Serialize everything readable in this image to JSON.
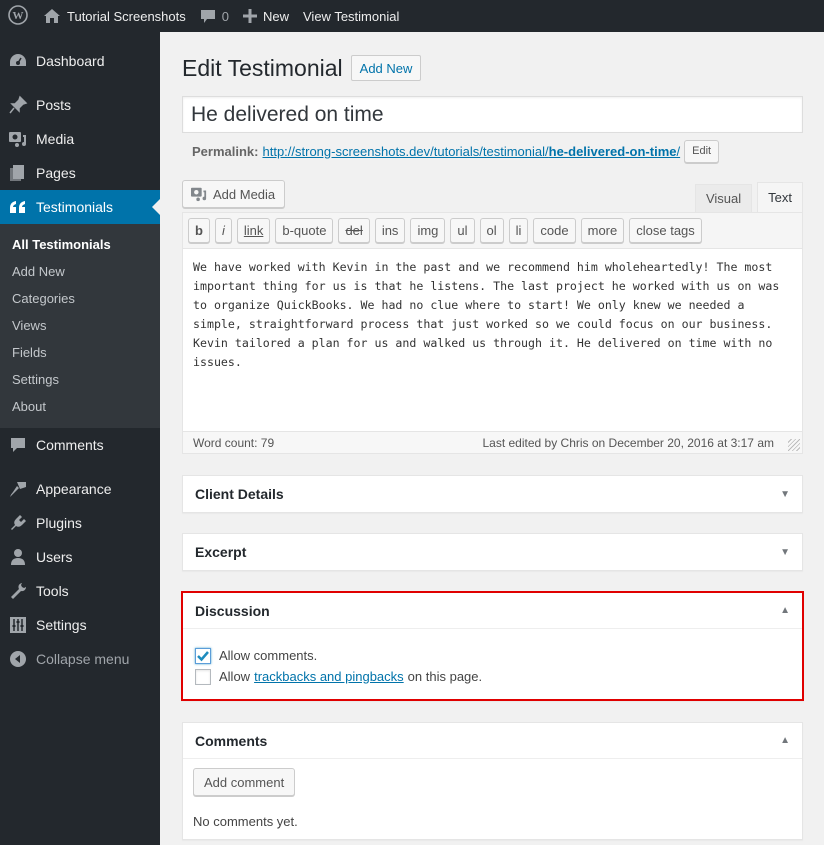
{
  "adminbar": {
    "site_name": "Tutorial Screenshots",
    "comments_count": "0",
    "new_label": "New",
    "view_label": "View Testimonial"
  },
  "sidebar": {
    "items": [
      {
        "label": "Dashboard",
        "icon": "dashboard-icon"
      },
      {
        "label": "Posts",
        "icon": "pin-icon"
      },
      {
        "label": "Media",
        "icon": "media-icon"
      },
      {
        "label": "Pages",
        "icon": "pages-icon"
      },
      {
        "label": "Testimonials",
        "icon": "quote-icon"
      },
      {
        "label": "Comments",
        "icon": "comment-icon"
      },
      {
        "label": "Appearance",
        "icon": "paintbrush-icon"
      },
      {
        "label": "Plugins",
        "icon": "plug-icon"
      },
      {
        "label": "Users",
        "icon": "user-icon"
      },
      {
        "label": "Tools",
        "icon": "wrench-icon"
      },
      {
        "label": "Settings",
        "icon": "sliders-icon"
      },
      {
        "label": "Collapse menu",
        "icon": "collapse-icon"
      }
    ],
    "submenu": [
      "All Testimonials",
      "Add New",
      "Categories",
      "Views",
      "Fields",
      "Settings",
      "About"
    ]
  },
  "main": {
    "page_title": "Edit Testimonial",
    "add_new_label": "Add New",
    "post_title": "He delivered on time",
    "permalink_label": "Permalink:",
    "permalink_base": "http://strong-screenshots.dev/tutorials/testimonial/",
    "permalink_slug": "he-delivered-on-time",
    "permalink_trailing": "/",
    "edit_label": "Edit",
    "add_media_label": "Add Media",
    "tabs": {
      "visual": "Visual",
      "text": "Text"
    },
    "quicktags": [
      "b",
      "i",
      "link",
      "b-quote",
      "del",
      "ins",
      "img",
      "ul",
      "ol",
      "li",
      "code",
      "more",
      "close tags"
    ],
    "content": "We have worked with Kevin in the past and we recommend him wholeheartedly! The most important thing for us is that he listens. The last project he worked with us on was to organize QuickBooks. We had no clue where to start! We only knew we needed a simple, straightforward process that just worked so we could focus on our business. Kevin tailored a plan for us and walked us through it. He delivered on time with no issues.",
    "word_count": "Word count: 79",
    "last_edited": "Last edited by Chris on December 20, 2016 at 3:17 am"
  },
  "boxes": {
    "client_details": "Client Details",
    "excerpt": "Excerpt",
    "discussion": {
      "title": "Discussion",
      "allow_comments": "Allow comments.",
      "allow_comments_checked": true,
      "allow_pings_prefix": "Allow",
      "allow_pings_link": "trackbacks and pingbacks",
      "allow_pings_suffix": "on this page.",
      "allow_pings_checked": false
    },
    "comments": {
      "title": "Comments",
      "add_comment_label": "Add comment",
      "empty_text": "No comments yet."
    }
  },
  "colors": {
    "accent": "#0073aa",
    "sidebar_bg": "#23282d",
    "highlight_border": "#e00000"
  }
}
